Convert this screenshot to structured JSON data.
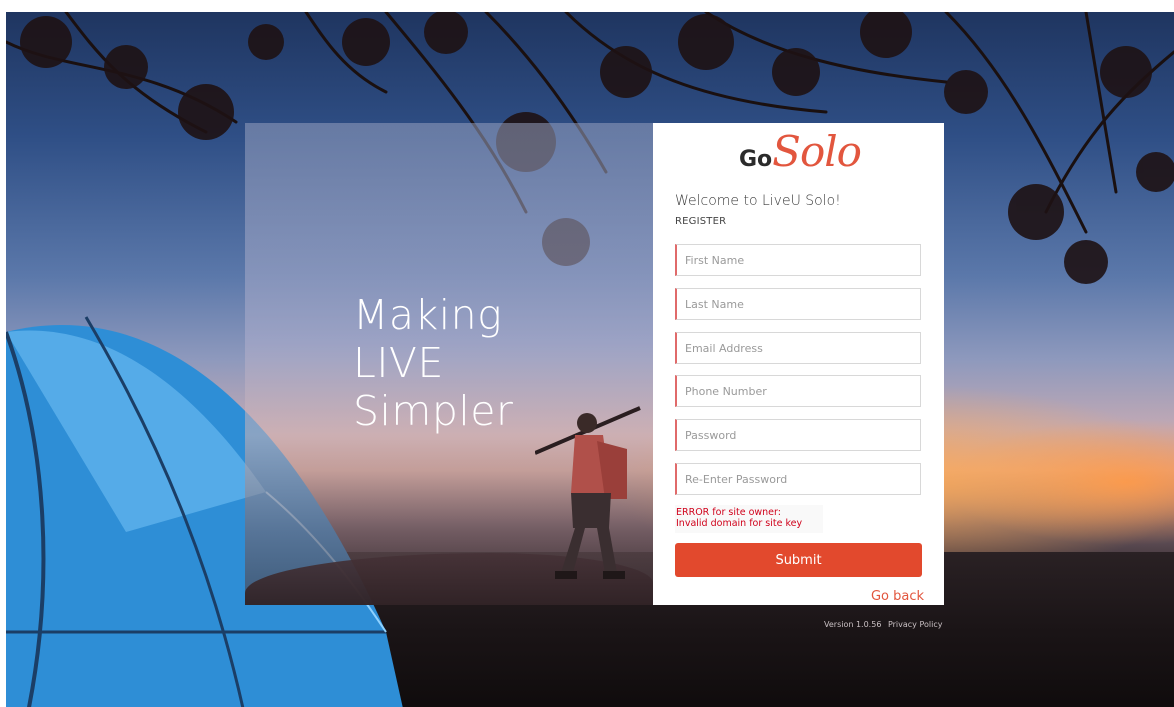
{
  "hero": {
    "line1": "Making",
    "line2": "LIVE",
    "line3": "Simpler"
  },
  "logo": {
    "go": "Go",
    "solo": "Solo"
  },
  "form": {
    "welcome": "Welcome to LiveU Solo!",
    "section_label": "REGISTER",
    "fields": {
      "first_name": {
        "placeholder": "First Name",
        "value": ""
      },
      "last_name": {
        "placeholder": "Last Name",
        "value": ""
      },
      "email": {
        "placeholder": "Email Address",
        "value": ""
      },
      "phone": {
        "placeholder": "Phone Number",
        "value": ""
      },
      "password": {
        "placeholder": "Password",
        "value": ""
      },
      "password_confirm": {
        "placeholder": "Re-Enter Password",
        "value": ""
      }
    },
    "recaptcha_error": {
      "line1": "ERROR for site owner:",
      "line2": "Invalid domain for site key"
    },
    "submit_label": "Submit",
    "go_back_label": "Go back"
  },
  "footer": {
    "version": "Version 1.0.56",
    "privacy": "Privacy Policy"
  },
  "colors": {
    "accent": "#e2492d",
    "logo_solo": "#e2563e",
    "error_text": "#d0021b",
    "field_left_border": "#e06a6a"
  }
}
